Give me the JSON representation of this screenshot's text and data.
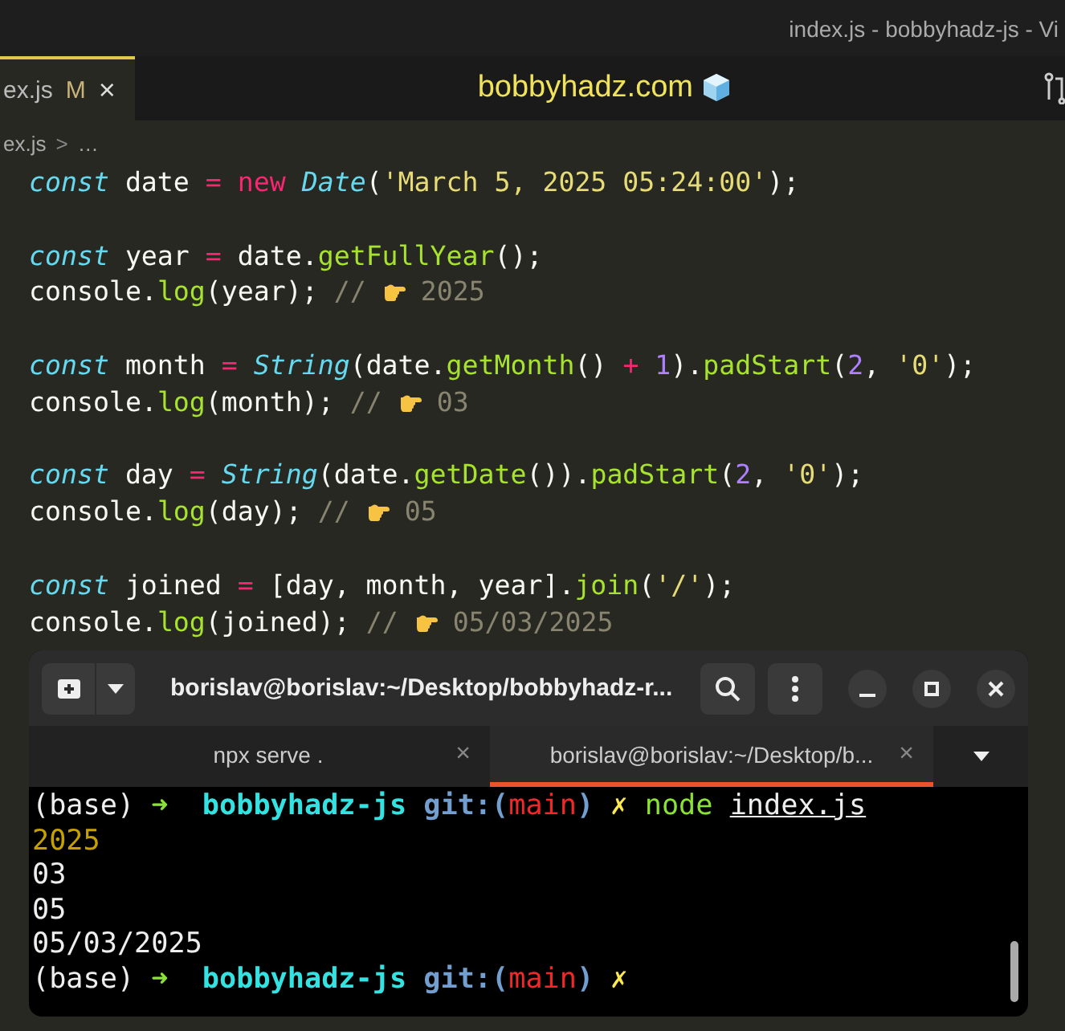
{
  "window": {
    "title": "index.js - bobbyhadz-js - Vi"
  },
  "tabs": [
    {
      "label": "ex.js",
      "badge": "M",
      "close": "×",
      "selected": true
    }
  ],
  "watermark_title": "bobbyhadz.com",
  "breadcrumb": {
    "file": "ex.js",
    "separator": ">",
    "rest": "…"
  },
  "code_lines": [
    {
      "kind": "code",
      "tokens": [
        {
          "kind": "keyword",
          "text": "const"
        },
        {
          "kind": "plain",
          "text": " date"
        },
        {
          "kind": "op",
          "text": " ="
        },
        {
          "kind": "op",
          "text": " new"
        },
        {
          "kind": "class",
          "text": " Date"
        },
        {
          "kind": "plain",
          "text": "("
        },
        {
          "kind": "str",
          "text": "'March 5, 2025 05:24:00'"
        },
        {
          "kind": "plain",
          "text": ");"
        }
      ]
    },
    {
      "kind": "blank"
    },
    {
      "kind": "code",
      "tokens": [
        {
          "kind": "keyword",
          "text": "const"
        },
        {
          "kind": "plain",
          "text": " year"
        },
        {
          "kind": "op",
          "text": " ="
        },
        {
          "kind": "plain",
          "text": " date."
        },
        {
          "kind": "fn",
          "text": "getFullYear"
        },
        {
          "kind": "plain",
          "text": "();"
        }
      ]
    },
    {
      "kind": "code",
      "tokens": [
        {
          "kind": "plain",
          "text": "console."
        },
        {
          "kind": "fn",
          "text": "log"
        },
        {
          "kind": "plain",
          "text": "(year);"
        },
        {
          "kind": "comment",
          "text": " //"
        },
        {
          "kind": "pointer"
        },
        {
          "kind": "comment",
          "text": "2025"
        }
      ]
    },
    {
      "kind": "blank"
    },
    {
      "kind": "code",
      "tokens": [
        {
          "kind": "keyword",
          "text": "const"
        },
        {
          "kind": "plain",
          "text": " month"
        },
        {
          "kind": "op",
          "text": " ="
        },
        {
          "kind": "class",
          "text": " String"
        },
        {
          "kind": "plain",
          "text": "(date."
        },
        {
          "kind": "fn",
          "text": "getMonth"
        },
        {
          "kind": "plain",
          "text": "()"
        },
        {
          "kind": "op",
          "text": " +"
        },
        {
          "kind": "num",
          "text": " 1"
        },
        {
          "kind": "plain",
          "text": ")."
        },
        {
          "kind": "fn",
          "text": "padStart"
        },
        {
          "kind": "plain",
          "text": "("
        },
        {
          "kind": "num",
          "text": "2"
        },
        {
          "kind": "plain",
          "text": ","
        },
        {
          "kind": "str",
          "text": " '0'"
        },
        {
          "kind": "plain",
          "text": ");"
        }
      ]
    },
    {
      "kind": "code",
      "tokens": [
        {
          "kind": "plain",
          "text": "console."
        },
        {
          "kind": "fn",
          "text": "log"
        },
        {
          "kind": "plain",
          "text": "(month);"
        },
        {
          "kind": "comment",
          "text": " //"
        },
        {
          "kind": "pointer"
        },
        {
          "kind": "comment",
          "text": "03"
        }
      ]
    },
    {
      "kind": "blank"
    },
    {
      "kind": "code",
      "tokens": [
        {
          "kind": "keyword",
          "text": "const"
        },
        {
          "kind": "plain",
          "text": " day"
        },
        {
          "kind": "op",
          "text": " ="
        },
        {
          "kind": "class",
          "text": " String"
        },
        {
          "kind": "plain",
          "text": "(date."
        },
        {
          "kind": "fn",
          "text": "getDate"
        },
        {
          "kind": "plain",
          "text": "())."
        },
        {
          "kind": "fn",
          "text": "padStart"
        },
        {
          "kind": "plain",
          "text": "("
        },
        {
          "kind": "num",
          "text": "2"
        },
        {
          "kind": "plain",
          "text": ","
        },
        {
          "kind": "str",
          "text": " '0'"
        },
        {
          "kind": "plain",
          "text": ");"
        }
      ]
    },
    {
      "kind": "code",
      "tokens": [
        {
          "kind": "plain",
          "text": "console."
        },
        {
          "kind": "fn",
          "text": "log"
        },
        {
          "kind": "plain",
          "text": "(day);"
        },
        {
          "kind": "comment",
          "text": " //"
        },
        {
          "kind": "pointer"
        },
        {
          "kind": "comment",
          "text": "05"
        }
      ]
    },
    {
      "kind": "blank"
    },
    {
      "kind": "code",
      "tokens": [
        {
          "kind": "keyword",
          "text": "const"
        },
        {
          "kind": "plain",
          "text": " joined"
        },
        {
          "kind": "op",
          "text": " ="
        },
        {
          "kind": "plain",
          "text": " [day, month, year]."
        },
        {
          "kind": "fn",
          "text": "join"
        },
        {
          "kind": "plain",
          "text": "("
        },
        {
          "kind": "str",
          "text": "'/'"
        },
        {
          "kind": "plain",
          "text": ");"
        }
      ]
    },
    {
      "kind": "code",
      "tokens": [
        {
          "kind": "plain",
          "text": "console."
        },
        {
          "kind": "fn",
          "text": "log"
        },
        {
          "kind": "plain",
          "text": "(joined);"
        },
        {
          "kind": "comment",
          "text": " //"
        },
        {
          "kind": "pointer"
        },
        {
          "kind": "comment",
          "text": "05/03/2025"
        }
      ]
    }
  ],
  "terminal": {
    "title": "borislav@borislav:~/Desktop/bobbyhadz-r...",
    "tabs": [
      {
        "label": "npx serve .",
        "close": "×",
        "selected": false
      },
      {
        "label": "borislav@borislav:~/Desktop/b...",
        "close": "×",
        "selected": true
      }
    ],
    "lines": [
      {
        "tokens": [
          {
            "kind": "plain",
            "text": "(base)"
          },
          {
            "kind": "arrow",
            "text": " ➜"
          },
          {
            "kind": "dir",
            "text": "  bobbyhadz-js"
          },
          {
            "kind": "git",
            "text": " git:("
          },
          {
            "kind": "branch",
            "text": "main"
          },
          {
            "kind": "git",
            "text": ")"
          },
          {
            "kind": "dirty",
            "text": " ✗"
          },
          {
            "kind": "cmd",
            "text": " node "
          },
          {
            "kind": "arg",
            "text": "index.js"
          }
        ]
      },
      {
        "tokens": [
          {
            "kind": "result",
            "text": "2025"
          }
        ]
      },
      {
        "tokens": [
          {
            "kind": "plain",
            "text": "03"
          }
        ]
      },
      {
        "tokens": [
          {
            "kind": "plain",
            "text": "05"
          }
        ]
      },
      {
        "tokens": [
          {
            "kind": "plain",
            "text": "05/03/2025"
          }
        ]
      },
      {
        "tokens": [
          {
            "kind": "plain",
            "text": "(base)"
          },
          {
            "kind": "arrow",
            "text": " ➜"
          },
          {
            "kind": "dir",
            "text": "  bobbyhadz-js"
          },
          {
            "kind": "git",
            "text": " git:("
          },
          {
            "kind": "branch",
            "text": "main"
          },
          {
            "kind": "git",
            "text": ")"
          },
          {
            "kind": "dirty",
            "text": " ✗"
          }
        ]
      }
    ]
  }
}
